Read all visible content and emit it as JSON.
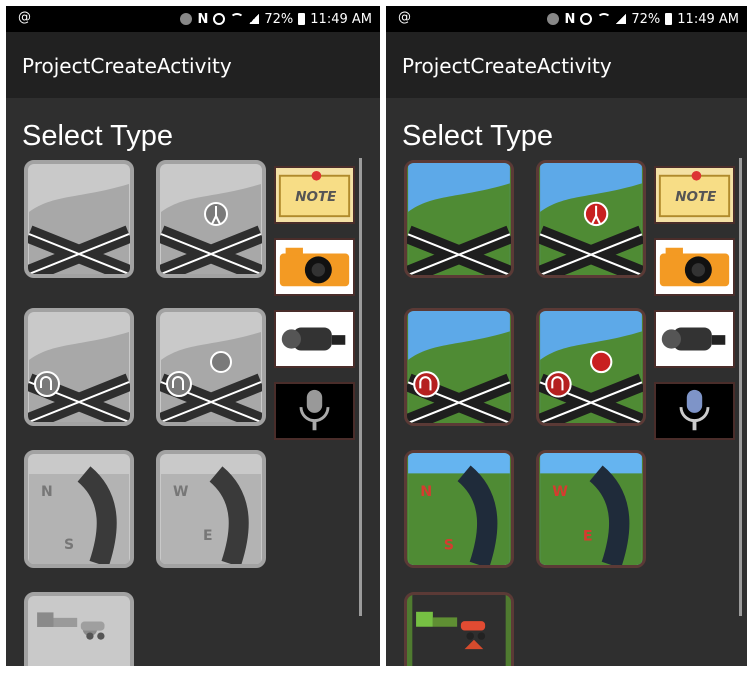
{
  "status": {
    "left_icon": "@",
    "battery": "72%",
    "time": "11:49 AM"
  },
  "app": {
    "title": "ProjectCreateActivity",
    "heading": "Select Type"
  },
  "colors": {
    "background": "#2f2f2f",
    "appbar": "#212121",
    "statusbar": "#000000",
    "grayscale_tile": "#c9c9c9",
    "color_tile_sky": "#58a7e6",
    "color_tile_grass": "#4f7b30"
  },
  "tiles": {
    "compass_letters": {
      "north": "N",
      "south": "S",
      "west": "W",
      "east": "E"
    }
  },
  "tool_icons": [
    "note-icon",
    "camera-icon",
    "video-camera-icon",
    "microphone-icon"
  ],
  "tool_text": {
    "note": "NOTE"
  }
}
